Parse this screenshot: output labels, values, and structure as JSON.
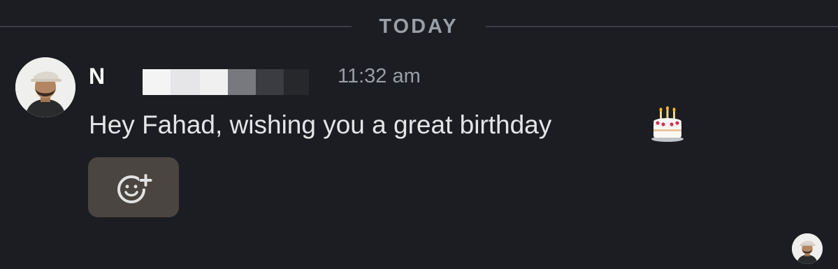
{
  "divider": {
    "label": "TODAY"
  },
  "message": {
    "sender_visible": "N",
    "timestamp": "11:32 am",
    "text": "Hey Fahad, wishing you a great birthday",
    "emoji": "birthday-cake-icon"
  },
  "reaction": {
    "icon": "add-reaction-icon"
  },
  "read_receipt": {
    "icon": "avatar"
  },
  "colors": {
    "background": "#1b1d22",
    "divider": "#3b3e45",
    "muted_text": "#9a9ea6",
    "message_text": "#e4e5e7",
    "reaction_bg": "#4a4540"
  }
}
